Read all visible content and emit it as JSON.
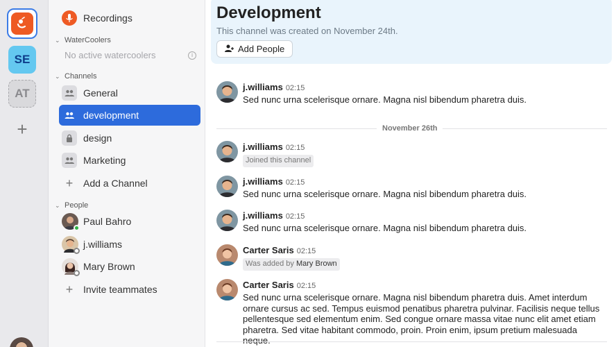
{
  "rail": {
    "workspaces": [
      {
        "label": "",
        "icon": "app-logo-icon"
      },
      {
        "label": "SE"
      },
      {
        "label": "AT"
      }
    ],
    "add_label": "+"
  },
  "sidebar": {
    "recordings_label": "Recordings",
    "watercoolers": {
      "header": "WaterCoolers",
      "empty_text": "No active watercoolers"
    },
    "channels": {
      "header": "Channels",
      "items": [
        {
          "label": "General",
          "icon": "people-icon"
        },
        {
          "label": "development",
          "icon": "people-icon",
          "active": true
        },
        {
          "label": "design",
          "icon": "lock-icon"
        },
        {
          "label": "Marketing",
          "icon": "people-icon"
        }
      ],
      "add_label": "Add a Channel"
    },
    "people": {
      "header": "People",
      "items": [
        {
          "label": "Paul Bahro",
          "status": "online"
        },
        {
          "label": "j.williams",
          "status": "offline"
        },
        {
          "label": "Mary Brown",
          "status": "offline"
        }
      ],
      "invite_label": "Invite teammates"
    }
  },
  "channel": {
    "title": "Development",
    "created_text": "This channel was created on November 24th.",
    "add_people_label": "Add People"
  },
  "date_divider": "November 26th",
  "messages": [
    {
      "author": "j.williams",
      "time": "02:15",
      "text": "Sed nunc urna scelerisque ornare. Magna nisl bibendum pharetra duis."
    },
    {
      "author": "j.williams",
      "time": "02:15",
      "system": "Joined this channel"
    },
    {
      "author": "j.williams",
      "time": "02:15",
      "text": "Sed nunc urna scelerisque ornare. Magna nisl bibendum pharetra duis."
    },
    {
      "author": "j.williams",
      "time": "02:15",
      "text": "Sed nunc urna scelerisque ornare. Magna nisl bibendum pharetra duis."
    },
    {
      "author": "Carter Saris",
      "time": "02:15",
      "system": "Was added by",
      "system_by": "Mary Brown"
    },
    {
      "author": "Carter Saris",
      "time": "02:15",
      "text": "Sed nunc urna scelerisque ornare. Magna nisl bibendum pharetra duis. Amet interdum ornare cursus ac sed. Tempus euismod penatibus pharetra pulvinar. Facilisis neque tellus pellentesque sed elementum enim. Sed congue ornare massa vitae nunc elit amet etiam pharetra. Sed vitae habitant commodo, proin. Proin enim, ipsum pretium malesuada neque."
    }
  ],
  "colors": {
    "accent": "#2d6bdc",
    "brand": "#ee5a24",
    "online": "#2fb344"
  }
}
